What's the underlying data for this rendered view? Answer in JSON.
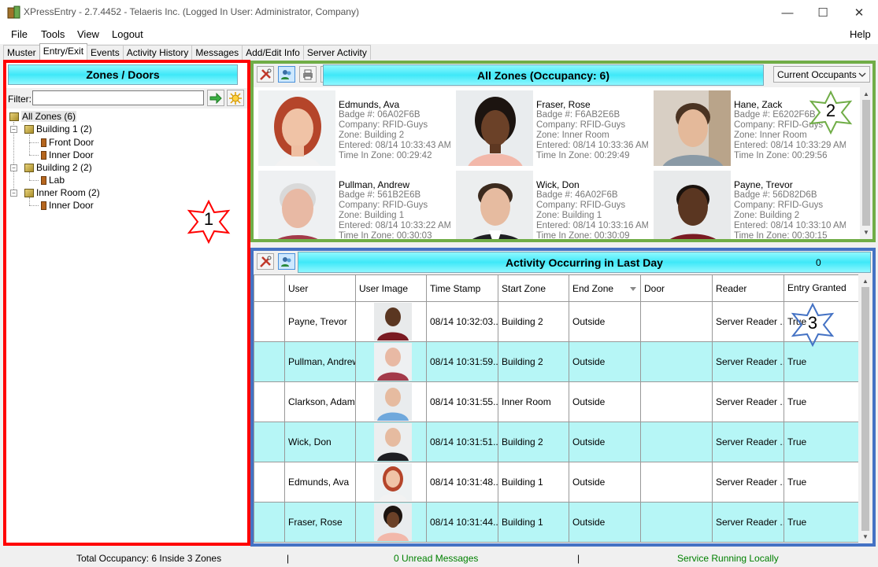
{
  "window": {
    "title": "XPressEntry - 2.7.4452 - Telaeris Inc. (Logged In User: Administrator, Company)",
    "minimize": "—",
    "maximize": "☐",
    "close": "✕"
  },
  "menu": {
    "file": "File",
    "tools": "Tools",
    "view": "View",
    "logout": "Logout",
    "help": "Help"
  },
  "tabs": [
    "Muster",
    "Entry/Exit",
    "Events",
    "Activity History",
    "Messages",
    "Add/Edit Info",
    "Server Activity"
  ],
  "zones_panel": {
    "header": "Zones / Doors",
    "filter_label": "Filter:",
    "filter_value": "",
    "tree": {
      "all": "All Zones (6)",
      "b1": "Building 1 (2)",
      "b1_front": "Front Door",
      "b1_inner": "Inner Door",
      "b2": "Building 2 (2)",
      "b2_lab": "Lab",
      "ir": "Inner Room (2)",
      "ir_inner": "Inner Door"
    }
  },
  "badges": {
    "one": "1",
    "two": "2",
    "three": "3"
  },
  "occupancy": {
    "title": "All Zones (Occupancy: 6)",
    "dropdown": "Current Occupants",
    "cards": [
      {
        "name": "Edmunds, Ava",
        "badge": "Badge #: 06A02F6B",
        "company": "Company: RFID-Guys",
        "zone": "Zone: Building 2",
        "entered": "Entered: 08/14 10:33:43 AM",
        "time": "Time In Zone: 00:29:42"
      },
      {
        "name": "Fraser, Rose",
        "badge": "Badge #: F6AB2E6B",
        "company": "Company: RFID-Guys",
        "zone": "Zone: Inner Room",
        "entered": "Entered: 08/14 10:33:36 AM",
        "time": "Time In Zone: 00:29:49"
      },
      {
        "name": "Hane, Zack",
        "badge": "Badge #: E6202F6B",
        "company": "Company: RFID-Guys",
        "zone": "Zone: Inner Room",
        "entered": "Entered: 08/14 10:33:29 AM",
        "time": "Time In Zone: 00:29:56"
      },
      {
        "name": "Pullman, Andrew",
        "badge": "Badge #: 561B2E6B",
        "company": "Company: RFID-Guys",
        "zone": "Zone: Building 1",
        "entered": "Entered: 08/14 10:33:22 AM",
        "time": "Time In Zone: 00:30:03"
      },
      {
        "name": "Wick, Don",
        "badge": "Badge #: 46A02F6B",
        "company": "Company: RFID-Guys",
        "zone": "Zone: Building 1",
        "entered": "Entered: 08/14 10:33:16 AM",
        "time": "Time In Zone: 00:30:09"
      },
      {
        "name": "Payne, Trevor",
        "badge": "Badge #: 56D82D6B",
        "company": "Company: RFID-Guys",
        "zone": "Zone: Building 2",
        "entered": "Entered: 08/14 10:33:10 AM",
        "time": "Time In Zone: 00:30:15"
      }
    ]
  },
  "activity": {
    "title": "Activity Occurring in Last Day",
    "count": "0",
    "columns": {
      "user": "User",
      "image": "User Image",
      "time": "Time Stamp",
      "start": "Start Zone",
      "end": "End Zone",
      "door": "Door",
      "reader": "Reader",
      "granted": "Entry Granted"
    },
    "rows": [
      {
        "user": "Payne, Trevor",
        "time": "08/14 10:32:03...",
        "start": "Building 2",
        "end": "Outside",
        "door": "",
        "reader": "Server Reader ...",
        "granted": "True"
      },
      {
        "user": "Pullman, Andrew",
        "time": "08/14 10:31:59...",
        "start": "Building 2",
        "end": "Outside",
        "door": "",
        "reader": "Server Reader ...",
        "granted": "True"
      },
      {
        "user": "Clarkson, Adam",
        "time": "08/14 10:31:55...",
        "start": "Inner Room",
        "end": "Outside",
        "door": "",
        "reader": "Server Reader ...",
        "granted": "True"
      },
      {
        "user": "Wick, Don",
        "time": "08/14 10:31:51...",
        "start": "Building 2",
        "end": "Outside",
        "door": "",
        "reader": "Server Reader ...",
        "granted": "True"
      },
      {
        "user": "Edmunds, Ava",
        "time": "08/14 10:31:48...",
        "start": "Building 1",
        "end": "Outside",
        "door": "",
        "reader": "Server Reader ...",
        "granted": "True"
      },
      {
        "user": "Fraser, Rose",
        "time": "08/14 10:31:44...",
        "start": "Building 1",
        "end": "Outside",
        "door": "",
        "reader": "Server Reader ...",
        "granted": "True"
      }
    ]
  },
  "status": {
    "occupancy": "Total Occupancy: 6 Inside 3 Zones",
    "sep": "|",
    "messages": "0 Unread Messages",
    "service": "Service Running Locally"
  },
  "colors": {
    "zones_outline": "#ff0000",
    "occupancy_outline": "#70ad47",
    "activity_outline": "#4472c4",
    "row_alt": "#b6f6f6",
    "status_green": "#008000"
  }
}
